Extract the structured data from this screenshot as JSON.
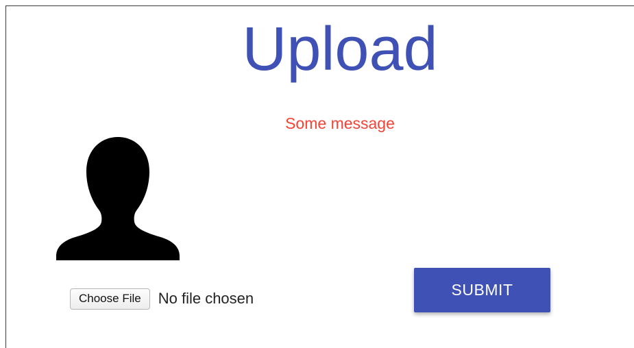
{
  "page": {
    "title": "Upload",
    "message": "Some message",
    "title_color": "#3f51b5",
    "message_color": "#f44336"
  },
  "avatar": {
    "icon": "person-silhouette-icon"
  },
  "file_input": {
    "button_label": "Choose File",
    "status": "No file chosen"
  },
  "submit": {
    "label": "SUBMIT",
    "color": "#3f51b5"
  }
}
